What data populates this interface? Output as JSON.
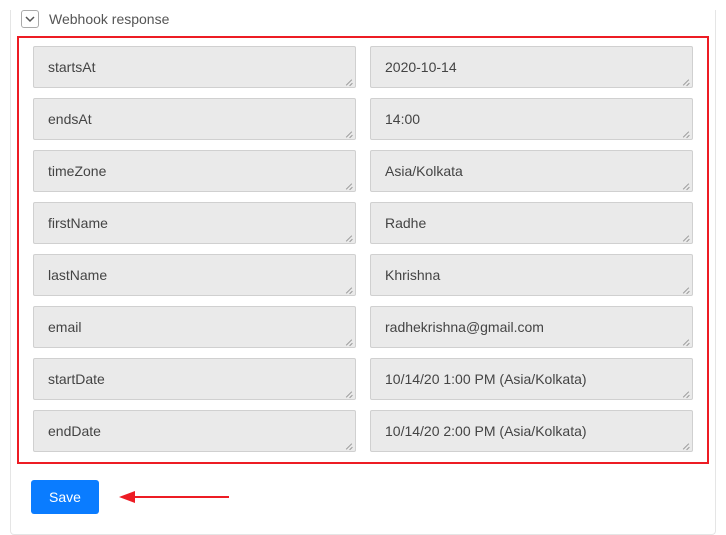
{
  "section": {
    "title": "Webhook response"
  },
  "fields": [
    {
      "key": "startsAt",
      "value": "2020-10-14"
    },
    {
      "key": "endsAt",
      "value": "14:00"
    },
    {
      "key": "timeZone",
      "value": "Asia/Kolkata"
    },
    {
      "key": "firstName",
      "value": "Radhe"
    },
    {
      "key": "lastName",
      "value": "Khrishna"
    },
    {
      "key": "email",
      "value": "radhekrishna@gmail.com"
    },
    {
      "key": "startDate",
      "value": "10/14/20 1:00 PM (Asia/Kolkata)"
    },
    {
      "key": "endDate",
      "value": "10/14/20 2:00 PM (Asia/Kolkata)"
    }
  ],
  "actions": {
    "save_label": "Save"
  }
}
